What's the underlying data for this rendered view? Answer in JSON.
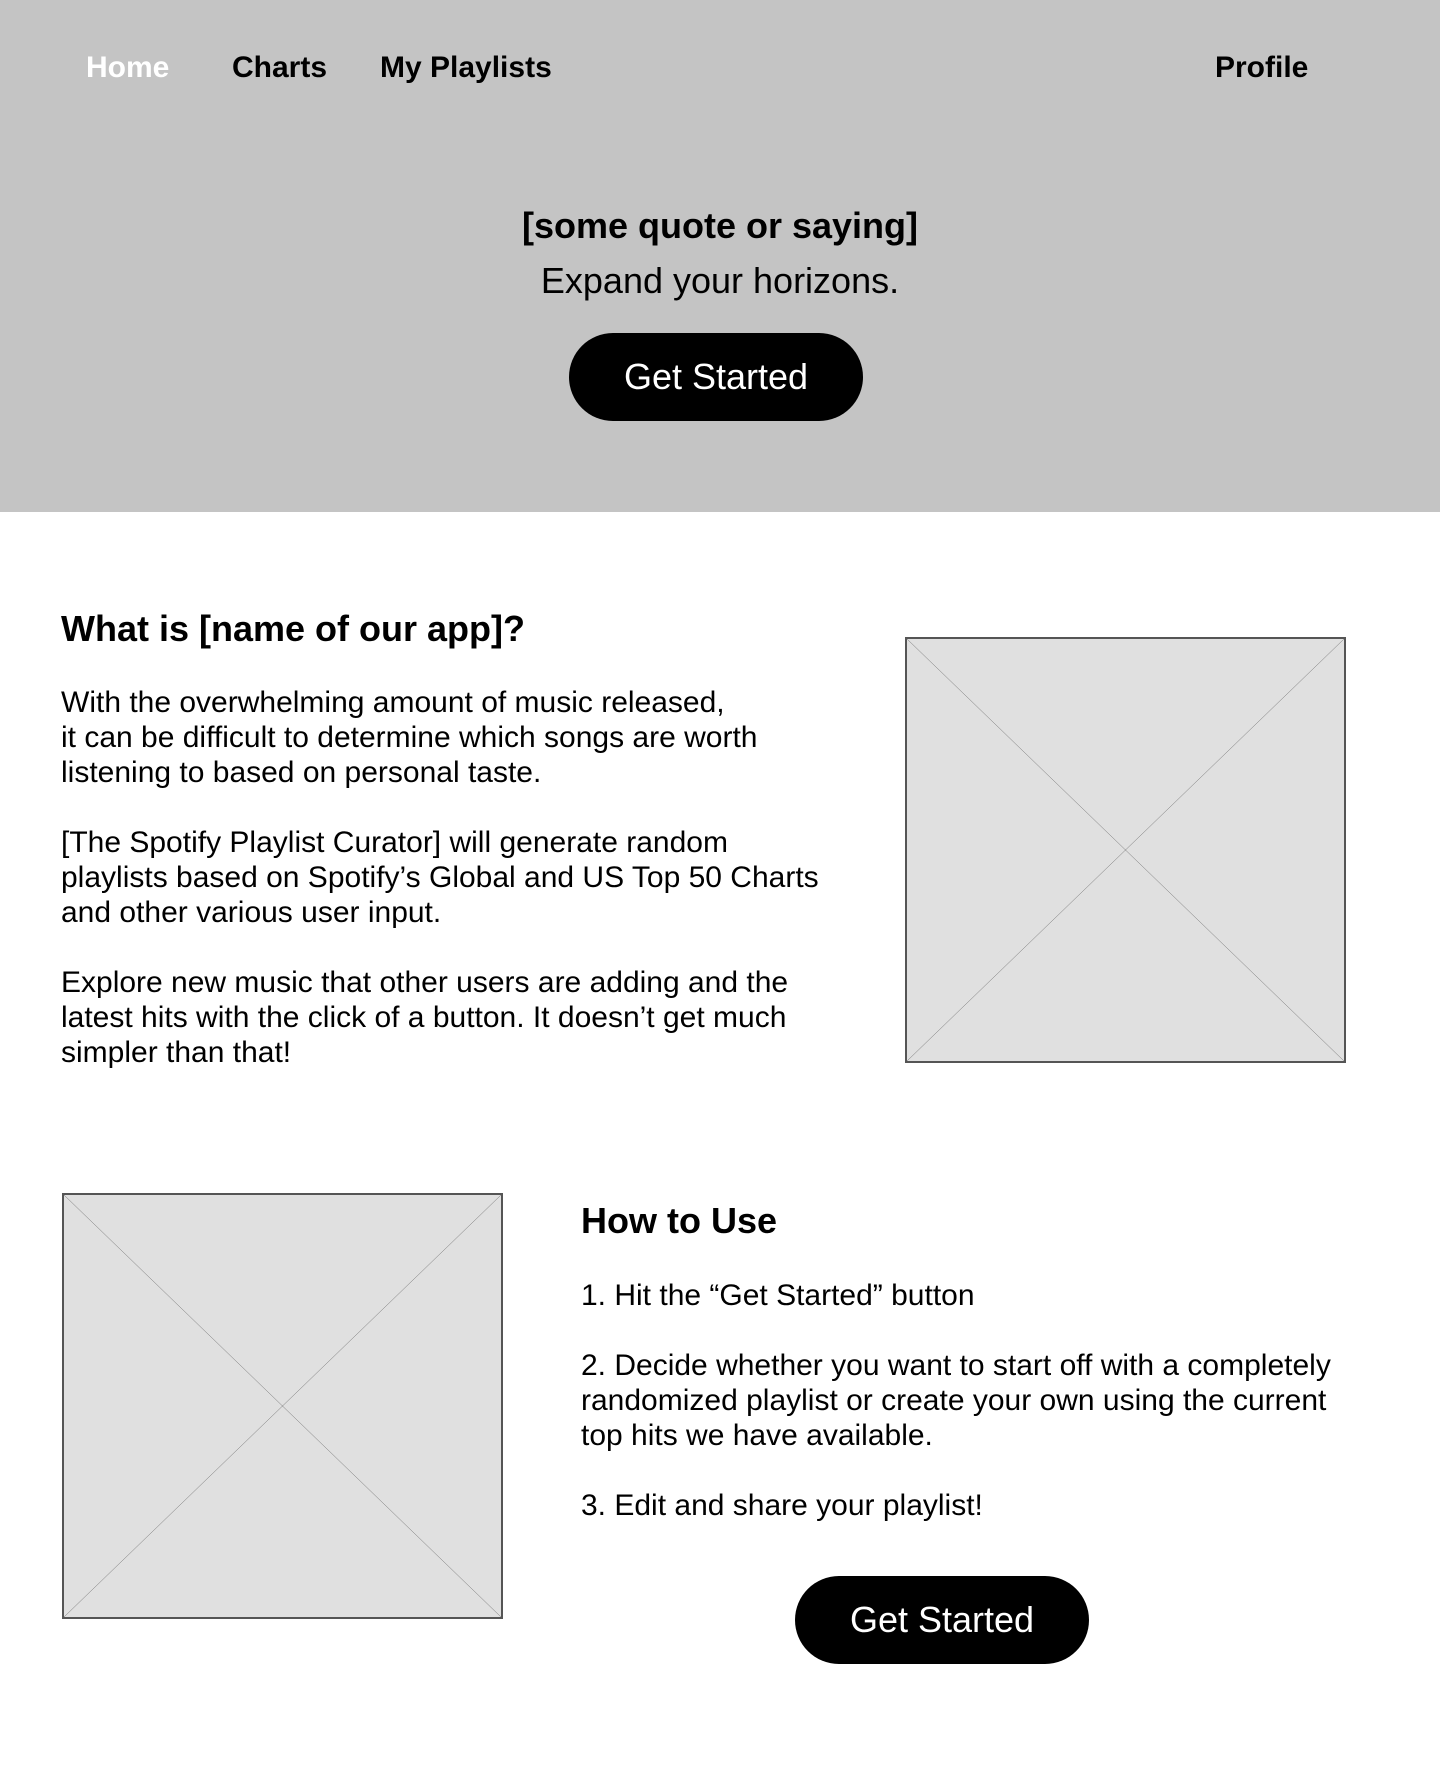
{
  "nav": {
    "home": "Home",
    "charts": "Charts",
    "playlists": "My Playlists",
    "profile": "Profile"
  },
  "hero": {
    "quote": "[some quote or saying]",
    "tagline": "Expand your horizons.",
    "button_label": "Get Started"
  },
  "about": {
    "title": "What is [name of our app]?",
    "p1": "With the overwhelming amount of music released,\nit can be difficult to determine which songs are worth\nlistening to based on personal taste.",
    "p2": "[The Spotify Playlist Curator] will generate random\nplaylists based on Spotify’s Global and US Top 50 Charts\nand other various user input.",
    "p3": "Explore new music that other users are adding and the\nlatest hits with the click of a button. It doesn’t get much\nsimpler than that!"
  },
  "how": {
    "title": "How to Use",
    "step1": "1. Hit the “Get Started” button",
    "step2": "2. Decide whether you want to start off with a completely\nrandomized playlist or create your own using the current\ntop hits we have available.",
    "step3": "3. Edit and share your playlist!",
    "button_label": "Get Started"
  },
  "colors": {
    "hero_bg": "#c4c4c4",
    "nav_active": "#ffffff",
    "button_bg": "#000000",
    "placeholder_bg": "#e0e0e0"
  }
}
